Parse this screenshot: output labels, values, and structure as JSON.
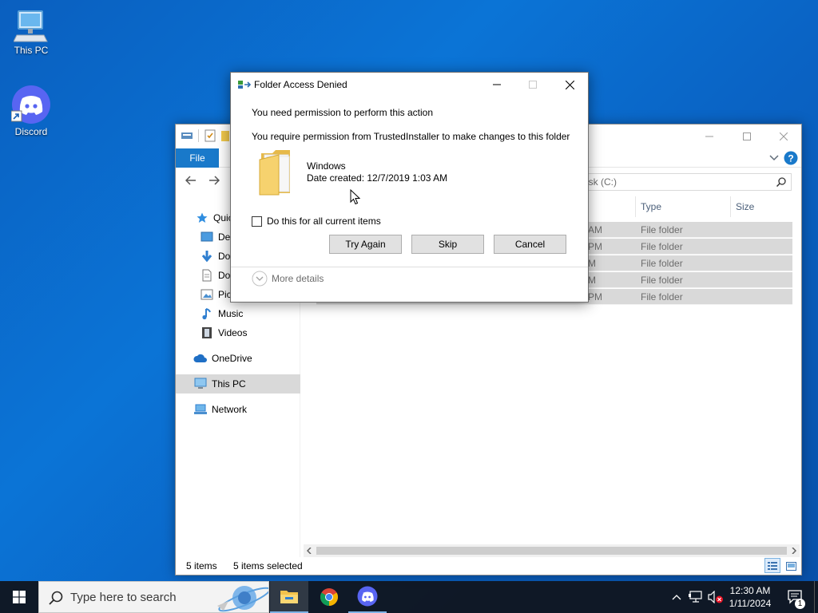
{
  "desktop": {
    "icons": [
      {
        "label": "This PC"
      },
      {
        "label": "Discord"
      }
    ]
  },
  "explorer": {
    "ribbon": {
      "file_tab": "File"
    },
    "search_placeholder": "isk (C:)",
    "nav": {
      "quick_access": "Quic",
      "desktop": "Des",
      "downloads": "Dov",
      "documents": "Doc",
      "pictures": "Pic",
      "music": "Music",
      "videos": "Videos",
      "onedrive": "OneDrive",
      "this_pc": "This PC",
      "network": "Network"
    },
    "columns": {
      "type": "Type",
      "size": "Size"
    },
    "rows": [
      {
        "time": "AM",
        "type": "File folder"
      },
      {
        "time": "PM",
        "type": "File folder"
      },
      {
        "time": "M",
        "type": "File folder"
      },
      {
        "time": "M",
        "type": "File folder"
      },
      {
        "time": "PM",
        "type": "File folder"
      }
    ],
    "status": {
      "items": "5 items",
      "selected": "5 items selected"
    }
  },
  "dialog": {
    "title": "Folder Access Denied",
    "heading": "You need permission to perform this action",
    "message": "You require permission from TrustedInstaller to make changes to this folder",
    "folder_name": "Windows",
    "date_created": "Date created: 12/7/2019 1:03 AM",
    "checkbox_label": "Do this for all current items",
    "checkbox_checked": false,
    "buttons": {
      "try_again": "Try Again",
      "skip": "Skip",
      "cancel": "Cancel"
    },
    "more_details": "More details"
  },
  "taskbar": {
    "search_placeholder": "Type here to search",
    "clock_time": "12:30 AM",
    "clock_date": "1/11/2024",
    "notification_count": "1"
  },
  "colors": {
    "desktop_bg": "#0b6fd0",
    "accent": "#1979ca",
    "taskbar": "#101620",
    "discord": "#5865f2"
  }
}
